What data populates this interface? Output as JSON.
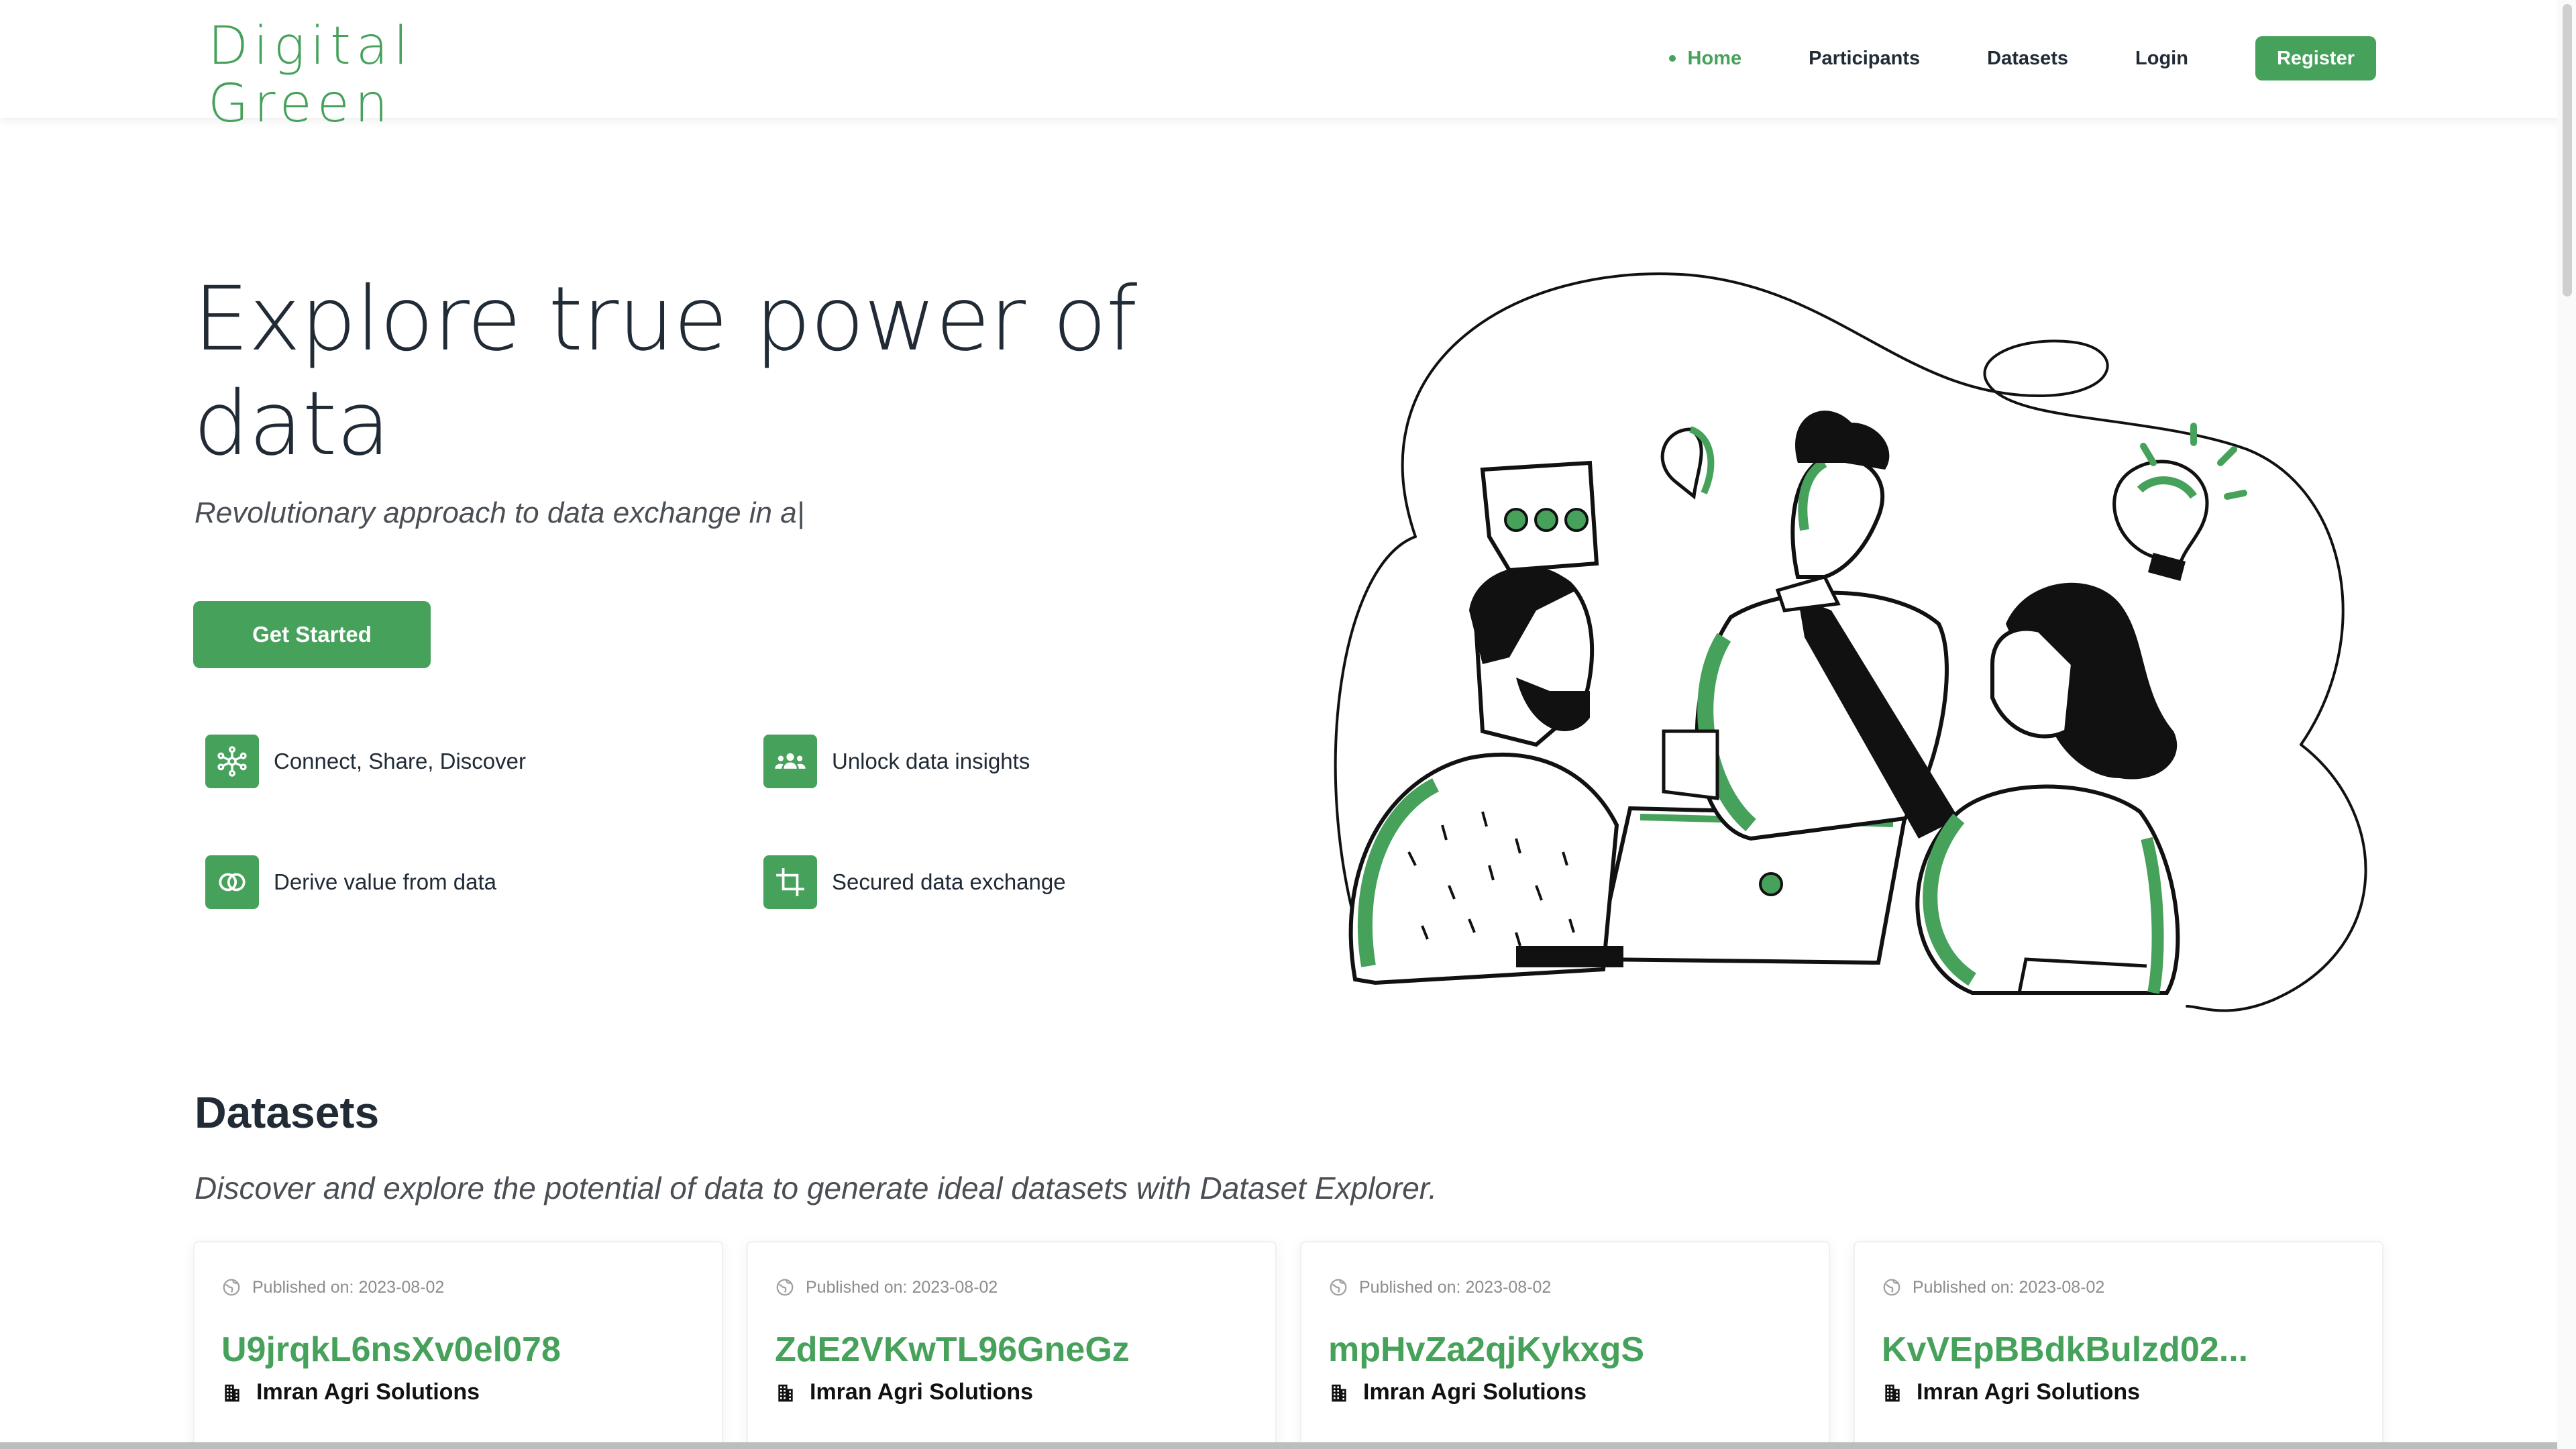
{
  "header": {
    "logo_line1": "Digital",
    "logo_line2": "Green",
    "nav": {
      "home": "Home",
      "participants": "Participants",
      "datasets": "Datasets",
      "login": "Login",
      "register": "Register"
    }
  },
  "hero": {
    "title": "Explore true power of data",
    "subtitle": "Revolutionary approach to data exchange in a|",
    "cta": "Get Started",
    "features": [
      {
        "label": "Connect, Share, Discover",
        "icon": "hub-icon"
      },
      {
        "label": "Unlock data insights",
        "icon": "groups-icon"
      },
      {
        "label": "Derive value from data",
        "icon": "toggle-icon"
      },
      {
        "label": "Secured data exchange",
        "icon": "crop-icon"
      }
    ]
  },
  "datasets": {
    "title": "Datasets",
    "subtitle": "Discover and explore the potential of data to generate ideal datasets with Dataset Explorer.",
    "cards": [
      {
        "published": "Published on: 2023-08-02",
        "name": "U9jrqkL6nsXv0el078",
        "org": "Imran Agri Solutions"
      },
      {
        "published": "Published on: 2023-08-02",
        "name": "ZdE2VKwTL96GneGz",
        "org": "Imran Agri Solutions"
      },
      {
        "published": "Published on: 2023-08-02",
        "name": "mpHvZa2qjKykxgS",
        "org": "Imran Agri Solutions"
      },
      {
        "published": "Published on: 2023-08-02",
        "name": "KvVEpBBdkBulzd02...",
        "org": "Imran Agri Solutions"
      }
    ]
  },
  "colors": {
    "brand_green": "#46a15b",
    "text_dark": "#212b36",
    "text_muted": "#8c8c8c"
  }
}
